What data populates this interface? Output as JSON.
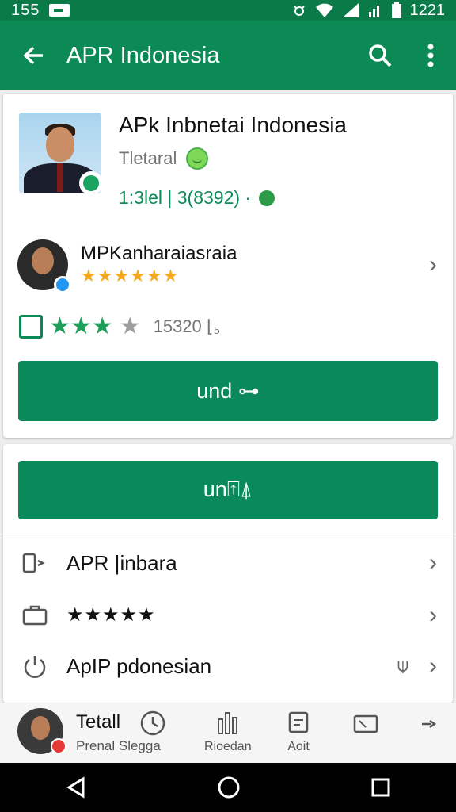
{
  "status_bar": {
    "left_time": "155",
    "right_time": "1221"
  },
  "app_bar": {
    "title": "APR Indonesia"
  },
  "app_card": {
    "title": "APk Inbnetai Indonesia",
    "subtitle": "Tletaral",
    "meta": "1:3lel  | 3(8392) ·",
    "developer": {
      "name": "MPKanharaiasraia",
      "stars": "★★★★★★"
    },
    "rating": {
      "stars_green": "★★★",
      "stars_gray": "★",
      "count": "15320 ⌊₅"
    },
    "primary_button": "und  ⊶"
  },
  "second_card": {
    "button": "un⍐⍋",
    "rows": [
      {
        "label": "APR |inbara",
        "icon": "phone-icon"
      },
      {
        "label": "★★★★★",
        "icon": "briefcase-icon"
      },
      {
        "label": "ApIP  pdonesian",
        "icon": "power-icon",
        "extra": "⍦"
      }
    ]
  },
  "bottom_bar": {
    "name": "Tetall",
    "sub": "Prenal Slegga",
    "tabs": [
      {
        "label": "",
        "icon": "clock-icon"
      },
      {
        "label": "Rioedan",
        "icon": "bar-chart-icon"
      },
      {
        "label": "Aoit",
        "icon": "doc-icon"
      },
      {
        "label": "",
        "icon": "tablet-icon"
      },
      {
        "label": "",
        "icon": "more-icon"
      }
    ]
  },
  "colors": {
    "primary": "#0b8a55",
    "status": "#0a7a49",
    "star": "#f2a91a"
  }
}
